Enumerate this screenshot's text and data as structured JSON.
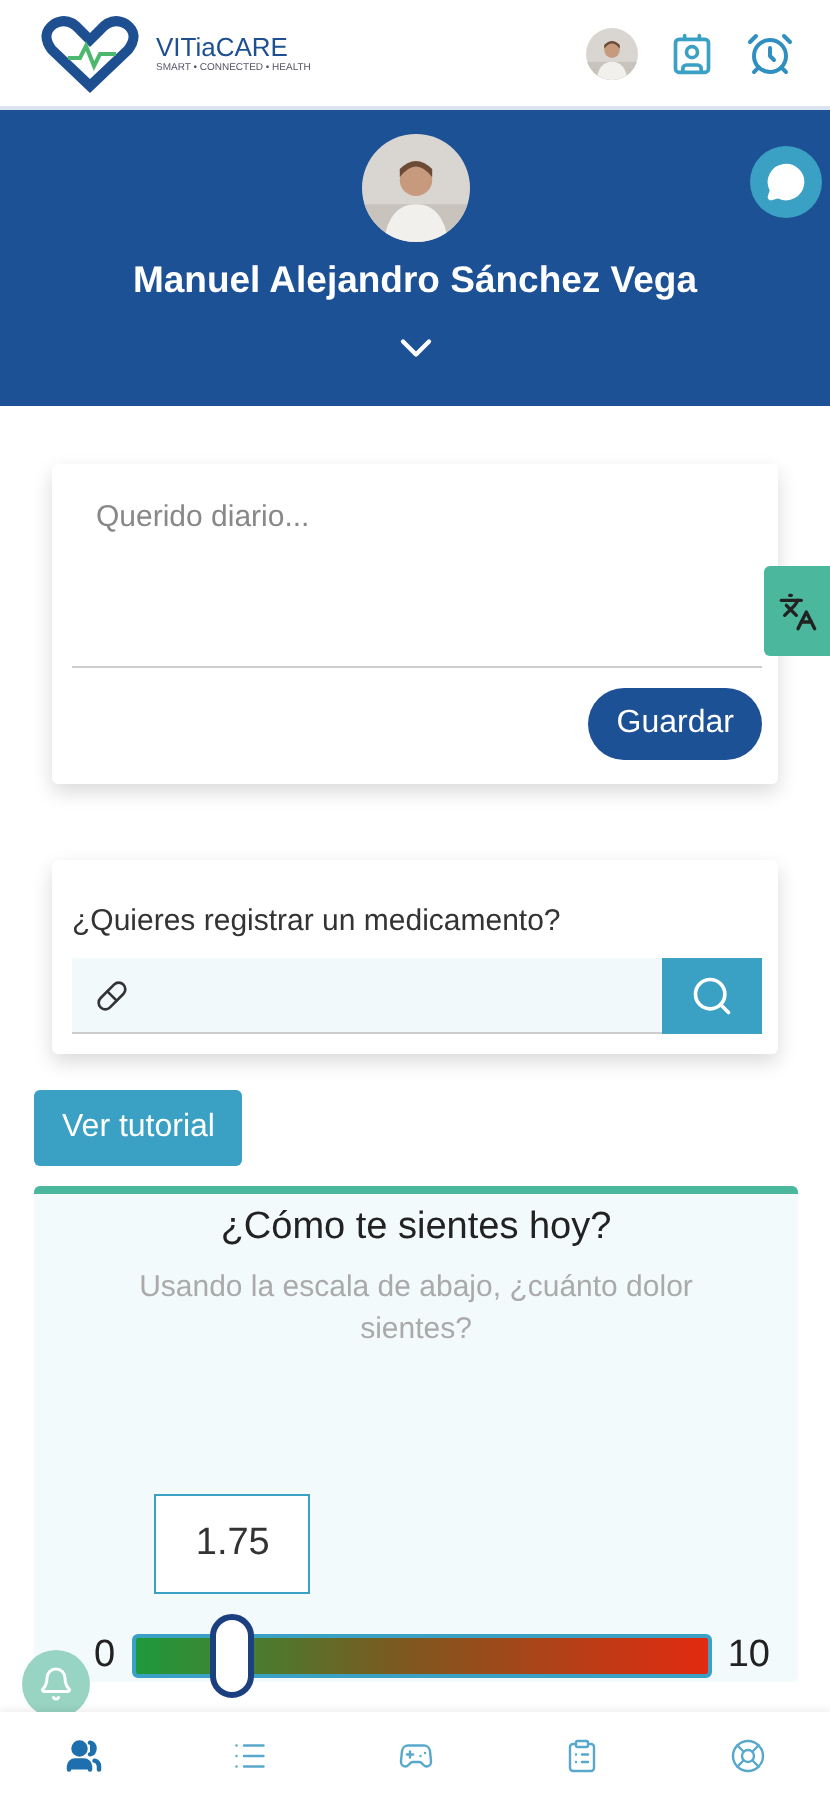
{
  "header": {
    "brand": "VITiaCARE",
    "tagline": "SMART • CONNECTED • HEALTH"
  },
  "profile": {
    "name": "Manuel Alejandro Sánchez Vega"
  },
  "diary": {
    "placeholder": "Querido diario...",
    "save_button": "Guardar"
  },
  "medication": {
    "question": "¿Quieres registrar un medicamento?"
  },
  "tutorial_button": "Ver tutorial",
  "pain": {
    "title": "¿Cómo te sientes hoy?",
    "subtitle": "Usando la escala de abajo, ¿cuánto dolor sientes?",
    "reading": "1.75",
    "min": "0",
    "max": "10",
    "level": 0.175
  },
  "bottom_nav": [
    {
      "selected": true
    },
    {
      "selected": false
    },
    {
      "selected": false
    },
    {
      "selected": false
    },
    {
      "selected": false
    }
  ]
}
